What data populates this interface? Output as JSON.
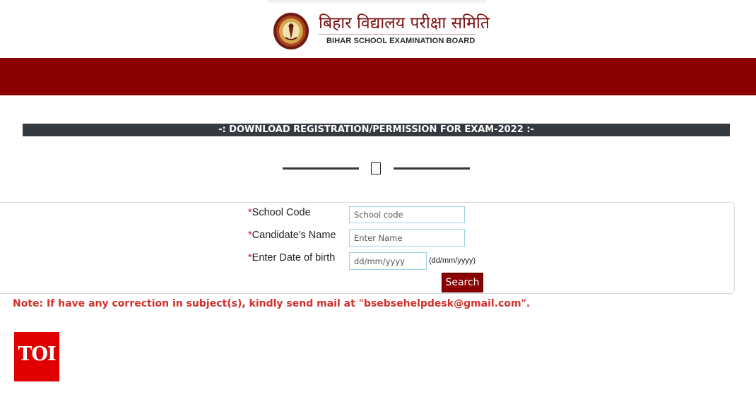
{
  "header": {
    "org_name_hindi": "बिहार विद्यालय परीक्षा समिति",
    "org_name_english": "BIHAR SCHOOL EXAMINATION BOARD",
    "logo_icon": "bseb-seal-icon"
  },
  "page": {
    "title": "-: DOWNLOAD REGISTRATION/PERMISSION FOR EXAM-2022 :-",
    "divider_icon": "empty-box-icon"
  },
  "form": {
    "required_marker": "*",
    "school_code": {
      "label": "School Code",
      "placeholder": "School code",
      "value": ""
    },
    "candidate_name": {
      "label": "Candidate's Name",
      "placeholder": "Enter Name",
      "value": ""
    },
    "date_of_birth": {
      "label": "Enter Date of birth",
      "placeholder": "dd/mm/yyyy",
      "format_hint": "(dd/mm/yyyy)",
      "value": ""
    },
    "search_label": "Search"
  },
  "note": "Note: If have any correction in subject(s), kindly send mail at \"bsebsehelpdesk@gmail.com\".",
  "watermark": {
    "text": "TOI"
  },
  "colors": {
    "brand_red": "#8b0000",
    "title_bar": "#343a40",
    "note_text": "#d0312d",
    "required_marker": "#c8102e",
    "input_border": "#9fd3e6",
    "watermark_bg": "#e10000"
  }
}
